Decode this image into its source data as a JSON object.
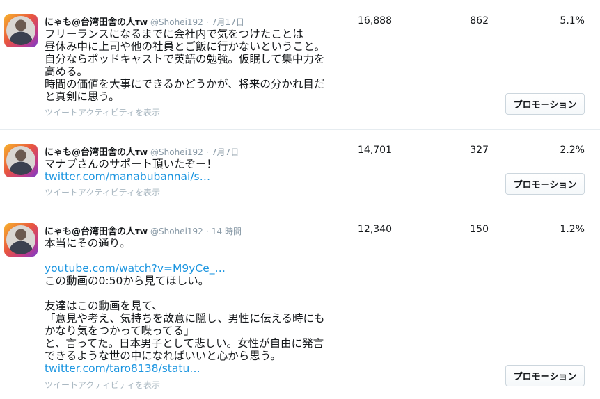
{
  "tweets": [
    {
      "author": {
        "name": "にゃも@台湾田舎の人",
        "suffix": "TW",
        "handle": "@Shohei192",
        "date": "7月17日"
      },
      "lines": [
        {
          "text": "フリーランスになるまでに会社内で気をつけたことは",
          "link": false
        },
        {
          "text": "昼休み中に上司や他の社員とご飯に行かないということ。",
          "link": false
        },
        {
          "text": "自分ならポッドキャストで英語の勉強。仮眠して集中力を",
          "link": false
        },
        {
          "text": "高める。",
          "link": false
        },
        {
          "text": "時間の価値を大事にできるかどうかが、将来の分かれ目だ",
          "link": false
        },
        {
          "text": "と真剣に思う。",
          "link": false
        }
      ],
      "activity": "ツイートアクティビティを表示",
      "impressions": "16,888",
      "engagements": "862",
      "engagement_rate": "5.1%",
      "promote_label": "プロモーション"
    },
    {
      "author": {
        "name": "にゃも@台湾田舎の人",
        "suffix": "TW",
        "handle": "@Shohei192",
        "date": "7月7日"
      },
      "lines": [
        {
          "text": "マナブさんのサポート頂いたぞー！",
          "link": false
        },
        {
          "text": "twitter.com/manabubannai/s…",
          "link": true
        }
      ],
      "activity": "ツイートアクティビティを表示",
      "impressions": "14,701",
      "engagements": "327",
      "engagement_rate": "2.2%",
      "promote_label": "プロモーション"
    },
    {
      "author": {
        "name": "にゃも@台湾田舎の人",
        "suffix": "TW",
        "handle": "@Shohei192",
        "date": "14 時間"
      },
      "lines": [
        {
          "text": "本当にその通り。",
          "link": false
        },
        {
          "text": "",
          "link": false
        },
        {
          "text": "youtube.com/watch?v=M9yCe_…",
          "link": true
        },
        {
          "text": "この動画の0:50から見てほしい。",
          "link": false
        },
        {
          "text": "",
          "link": false
        },
        {
          "text": "友達はこの動画を見て、",
          "link": false
        },
        {
          "text": "「意見や考え、気持ちを故意に隠し、男性に伝える時にも",
          "link": false
        },
        {
          "text": "かなり気をつかって喋ってる」",
          "link": false
        },
        {
          "text": "と、言ってた。日本男子として悲しい。女性が自由に発言",
          "link": false
        },
        {
          "text": "できるような世の中になればいいと心から思う。",
          "link": false
        },
        {
          "text": "twitter.com/taro8138/statu…",
          "link": true
        }
      ],
      "activity": "ツイートアクティビティを表示",
      "impressions": "12,340",
      "engagements": "150",
      "engagement_rate": "1.2%",
      "promote_label": "プロモーション"
    }
  ],
  "colors": {
    "link": "#1b95e0",
    "muted": "#8899a6",
    "divider": "#e6ecf0"
  }
}
